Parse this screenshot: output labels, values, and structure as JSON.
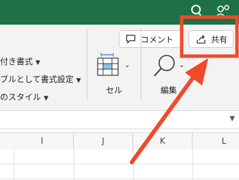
{
  "ribbon": {
    "style_items": [
      "付き書式",
      "ブルとして書式設定",
      "のスタイル"
    ],
    "cells_label": "セル",
    "edit_label": "編集",
    "comment_label": "コメント",
    "share_label": "共有"
  },
  "columns": [
    "I",
    "J",
    "K",
    "L"
  ],
  "colors": {
    "titlebar": "#1e7145",
    "annotation": "#f04a2b"
  },
  "icons": [
    "search-icon",
    "people-icon",
    "comment-icon",
    "share-icon",
    "cells-icon",
    "magnifier-icon",
    "chevron-down-icon"
  ]
}
